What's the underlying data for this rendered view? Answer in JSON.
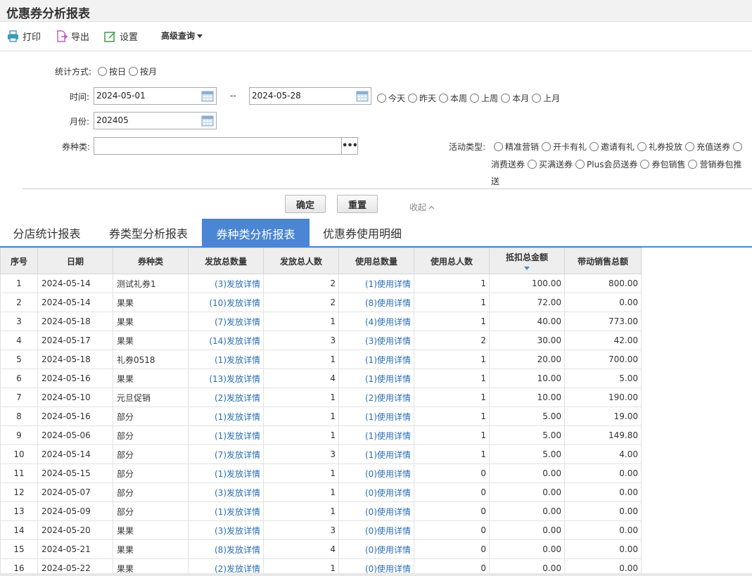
{
  "page": {
    "title": "优惠券分析报表"
  },
  "toolbar": {
    "print": "打印",
    "export": "导出",
    "settings": "设置",
    "advanced": "高级查询"
  },
  "filters": {
    "stat_mode_label": "统计方式:",
    "stat_mode_options": [
      "按日",
      "按月"
    ],
    "time_label": "时间:",
    "date_from": "2024-05-01",
    "date_sep": "--",
    "date_to": "2024-05-28",
    "quick_options": [
      "今天",
      "昨天",
      "本周",
      "上周",
      "本月",
      "上月"
    ],
    "month_label": "月份:",
    "month_value": "202405",
    "coupon_type_label": "券种类:",
    "coupon_type_value": "",
    "activity_label": "活动类型:",
    "activity_row1": [
      "精准营销",
      "开卡有礼",
      "邀请有礼",
      "礼券投放",
      "充值送券"
    ],
    "activity_row2": [
      "消费送券",
      "买满送券",
      "Plus会员送券",
      "券包销售",
      "营销券包推"
    ],
    "activity_row3_tail": "送"
  },
  "buttons": {
    "confirm": "确定",
    "reset": "重置",
    "collapse": "收起"
  },
  "tabs": [
    "分店统计报表",
    "券类型分析报表",
    "券种类分析报表",
    "优惠券使用明细"
  ],
  "active_tab": 2,
  "table": {
    "headers": [
      "序号",
      "日期",
      "券种类",
      "发放总数量",
      "发放总人数",
      "使用总数量",
      "使用总人数",
      "抵扣总金额",
      "带动销售总额"
    ],
    "rows": [
      [
        "1",
        "2024-05-14",
        "测试礼券1",
        "(3)发放详情",
        "2",
        "(1)使用详情",
        "1",
        "100.00",
        "800.00"
      ],
      [
        "2",
        "2024-05-14",
        "果果",
        "(10)发放详情",
        "2",
        "(8)使用详情",
        "1",
        "72.00",
        "0.00"
      ],
      [
        "3",
        "2024-05-18",
        "果果",
        "(7)发放详情",
        "1",
        "(4)使用详情",
        "1",
        "40.00",
        "773.00"
      ],
      [
        "4",
        "2024-05-17",
        "果果",
        "(14)发放详情",
        "3",
        "(3)使用详情",
        "2",
        "30.00",
        "42.00"
      ],
      [
        "5",
        "2024-05-18",
        "礼券0518",
        "(1)发放详情",
        "1",
        "(1)使用详情",
        "1",
        "20.00",
        "700.00"
      ],
      [
        "6",
        "2024-05-16",
        "果果",
        "(13)发放详情",
        "4",
        "(1)使用详情",
        "1",
        "10.00",
        "5.00"
      ],
      [
        "7",
        "2024-05-10",
        "元旦促销",
        "(2)发放详情",
        "1",
        "(2)使用详情",
        "1",
        "10.00",
        "190.00"
      ],
      [
        "8",
        "2024-05-16",
        "部分",
        "(1)发放详情",
        "1",
        "(1)使用详情",
        "1",
        "5.00",
        "19.00"
      ],
      [
        "9",
        "2024-05-06",
        "部分",
        "(1)发放详情",
        "1",
        "(1)使用详情",
        "1",
        "5.00",
        "149.80"
      ],
      [
        "10",
        "2024-05-14",
        "部分",
        "(7)发放详情",
        "3",
        "(1)使用详情",
        "1",
        "5.00",
        "4.00"
      ],
      [
        "11",
        "2024-05-15",
        "部分",
        "(1)发放详情",
        "1",
        "(0)使用详情",
        "0",
        "0.00",
        "0.00"
      ],
      [
        "12",
        "2024-05-07",
        "部分",
        "(3)发放详情",
        "1",
        "(0)使用详情",
        "0",
        "0.00",
        "0.00"
      ],
      [
        "13",
        "2024-05-09",
        "部分",
        "(1)发放详情",
        "1",
        "(0)使用详情",
        "0",
        "0.00",
        "0.00"
      ],
      [
        "14",
        "2024-05-20",
        "果果",
        "(3)发放详情",
        "3",
        "(0)使用详情",
        "0",
        "0.00",
        "0.00"
      ],
      [
        "15",
        "2024-05-21",
        "果果",
        "(8)发放详情",
        "4",
        "(0)使用详情",
        "0",
        "0.00",
        "0.00"
      ],
      [
        "16",
        "2024-05-22",
        "果果",
        "(2)发放详情",
        "1",
        "(0)使用详情",
        "0",
        "0.00",
        "0.00"
      ]
    ]
  },
  "colors": {
    "accent": "#4a86d3",
    "link": "#2a6fb5",
    "header_bg": "#eeeeee"
  },
  "icons": {
    "print": "printer-icon",
    "export": "export-file-icon",
    "settings": "edit-settings-icon",
    "calendar": "calendar-icon"
  }
}
